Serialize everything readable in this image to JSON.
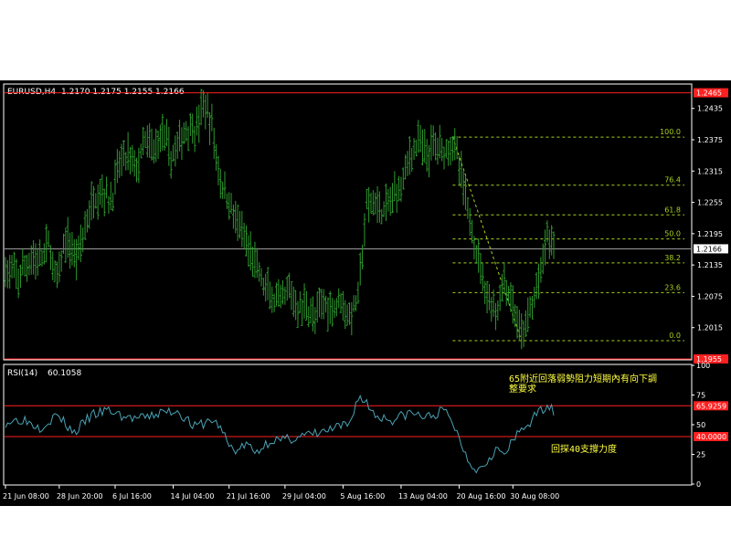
{
  "colors": {
    "background": "#000000",
    "frame": "#ffffff",
    "bars": "#2f9a2f",
    "rsi_line": "#4aa3b5",
    "level_line": "#ff2020",
    "fib_line": "#a8d020",
    "trend_line": "#a8d020",
    "price_marker": "#ffffff",
    "annotation": "#ffff40",
    "tick_text": "#ffffff"
  },
  "chart_data": [
    {
      "type": "ohlc",
      "title": "EURUSD,H4",
      "ohlc_readout": "1.2170 1.2175 1.2155 1.2166",
      "ylim": [
        1.1955,
        1.248
      ],
      "yticks": [
        "1.2435",
        "1.2375",
        "1.2315",
        "1.2255",
        "1.2195",
        "1.2135",
        "1.2075",
        "1.2015"
      ],
      "xticks": [
        "21 Jun 08:00",
        "28 Jun 20:00",
        "6 Jul 16:00",
        "14 Jul 04:00",
        "21 Jul 16:00",
        "29 Jul 04:00",
        "5 Aug 16:00",
        "13 Aug 04:00",
        "20 Aug 16:00",
        "30 Aug 08:00"
      ],
      "path_points": [
        [
          0,
          1.2125
        ],
        [
          6,
          1.211
        ],
        [
          12,
          1.215
        ],
        [
          16,
          1.214
        ],
        [
          20,
          1.2175
        ],
        [
          24,
          1.21
        ],
        [
          28,
          1.2185
        ],
        [
          33,
          1.215
        ],
        [
          37,
          1.2205
        ],
        [
          41,
          1.2265
        ],
        [
          45,
          1.228
        ],
        [
          49,
          1.2255
        ],
        [
          53,
          1.233
        ],
        [
          57,
          1.2345
        ],
        [
          61,
          1.232
        ],
        [
          65,
          1.237
        ],
        [
          69,
          1.2355
        ],
        [
          73,
          1.239
        ],
        [
          77,
          1.234
        ],
        [
          81,
          1.237
        ],
        [
          85,
          1.24
        ],
        [
          89,
          1.2395
        ],
        [
          92,
          1.2445
        ],
        [
          96,
          1.24
        ],
        [
          100,
          1.2295
        ],
        [
          104,
          1.2255
        ],
        [
          108,
          1.2215
        ],
        [
          112,
          1.217
        ],
        [
          116,
          1.214
        ],
        [
          120,
          1.2095
        ],
        [
          124,
          1.207
        ],
        [
          128,
          1.206
        ],
        [
          132,
          1.2085
        ],
        [
          136,
          1.205
        ],
        [
          140,
          1.206
        ],
        [
          144,
          1.203
        ],
        [
          148,
          1.2065
        ],
        [
          152,
          1.205
        ],
        [
          156,
          1.2075
        ],
        [
          160,
          1.203
        ],
        [
          164,
          1.2075
        ],
        [
          168,
          1.2245
        ],
        [
          172,
          1.2255
        ],
        [
          176,
          1.2235
        ],
        [
          180,
          1.2265
        ],
        [
          184,
          1.229
        ],
        [
          188,
          1.2345
        ],
        [
          192,
          1.237
        ],
        [
          196,
          1.2345
        ],
        [
          200,
          1.237
        ],
        [
          204,
          1.2355
        ],
        [
          208,
          1.2375
        ],
        [
          212,
          1.2305
        ],
        [
          216,
          1.222
        ],
        [
          220,
          1.215
        ],
        [
          224,
          1.208
        ],
        [
          228,
          1.204
        ],
        [
          232,
          1.2105
        ],
        [
          236,
          1.2055
        ],
        [
          240,
          1.1995
        ],
        [
          244,
          1.2045
        ],
        [
          248,
          1.21
        ],
        [
          252,
          1.2195
        ],
        [
          255,
          1.217
        ]
      ],
      "n_bars": 256,
      "horizontal_levels": [
        {
          "price": 1.2465,
          "label": "1.2465"
        },
        {
          "price": 1.1955,
          "label": "1.1955"
        }
      ],
      "current_price": {
        "price": 1.2166,
        "label": "1.2166"
      },
      "fibonacci": {
        "high": 1.238,
        "low": 1.199,
        "levels": [
          {
            "ratio": 1.0,
            "label": "100.0"
          },
          {
            "ratio": 0.764,
            "label": "76.4"
          },
          {
            "ratio": 0.618,
            "label": "61.8"
          },
          {
            "ratio": 0.5,
            "label": "50.0"
          },
          {
            "ratio": 0.382,
            "label": "38.2"
          },
          {
            "ratio": 0.236,
            "label": "23.6"
          },
          {
            "ratio": 0.0,
            "label": "0.0"
          }
        ],
        "start_bar": 208,
        "end_bar": 240
      }
    },
    {
      "type": "line",
      "title": "RSI(14)",
      "value_readout": "60.1058",
      "ylim": [
        0,
        100
      ],
      "yticks": [
        "100",
        "75",
        "50",
        "25",
        "0"
      ],
      "levels": [
        {
          "value": 65.9259,
          "label": "65.9259"
        },
        {
          "value": 40.0,
          "label": "40.0000"
        }
      ],
      "path_points": [
        [
          0,
          52
        ],
        [
          8,
          55
        ],
        [
          16,
          48
        ],
        [
          24,
          58
        ],
        [
          32,
          43
        ],
        [
          40,
          58
        ],
        [
          48,
          62
        ],
        [
          56,
          56
        ],
        [
          64,
          55
        ],
        [
          72,
          60
        ],
        [
          80,
          62
        ],
        [
          88,
          48
        ],
        [
          96,
          54
        ],
        [
          100,
          48
        ],
        [
          104,
          32
        ],
        [
          108,
          28
        ],
        [
          112,
          34
        ],
        [
          116,
          26
        ],
        [
          120,
          32
        ],
        [
          124,
          38
        ],
        [
          128,
          36
        ],
        [
          136,
          40
        ],
        [
          144,
          42
        ],
        [
          152,
          46
        ],
        [
          160,
          50
        ],
        [
          164,
          74
        ],
        [
          168,
          68
        ],
        [
          172,
          58
        ],
        [
          180,
          54
        ],
        [
          188,
          60
        ],
        [
          196,
          56
        ],
        [
          204,
          62
        ],
        [
          208,
          52
        ],
        [
          212,
          34
        ],
        [
          216,
          18
        ],
        [
          220,
          12
        ],
        [
          224,
          20
        ],
        [
          228,
          30
        ],
        [
          232,
          24
        ],
        [
          236,
          36
        ],
        [
          240,
          46
        ],
        [
          244,
          52
        ],
        [
          248,
          60
        ],
        [
          252,
          68
        ],
        [
          255,
          60
        ]
      ]
    }
  ],
  "annotations": {
    "rsi_note_top": "65附近回落弱勢阻力短期內有向下調整要求",
    "rsi_note_bottom": "回探40支撐力度"
  }
}
